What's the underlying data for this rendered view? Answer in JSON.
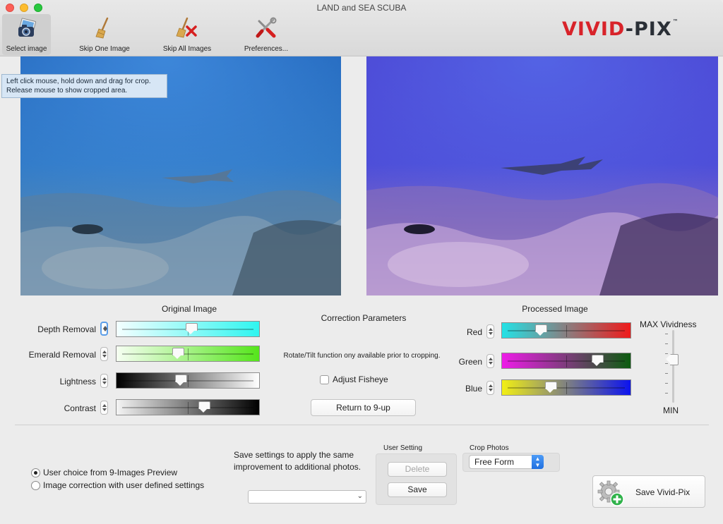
{
  "window": {
    "title": "LAND and SEA SCUBA"
  },
  "toolbar": {
    "items": [
      {
        "label": "Select image",
        "icon": "camera-icon"
      },
      {
        "label": "Skip One Image",
        "icon": "broom-icon"
      },
      {
        "label": "Skip All Images",
        "icon": "broom-cross-icon"
      },
      {
        "label": "Preferences...",
        "icon": "tools-icon"
      }
    ]
  },
  "logo": {
    "part1": "VIVID",
    "part2": "-PIX",
    "tm": "™"
  },
  "tooltip": {
    "line1": "Left click mouse, hold down and drag for crop.",
    "line2": "Release mouse to show cropped area."
  },
  "original": {
    "title": "Original Image",
    "sliders": [
      {
        "label": "Depth Removal",
        "value": 0.52,
        "colors": [
          "#f4ffff",
          "#2ff5f0"
        ]
      },
      {
        "label": "Emerald Removal",
        "value": 0.42,
        "colors": [
          "#f6fff2",
          "#55e51b"
        ]
      },
      {
        "label": "Lightness",
        "value": 0.44,
        "colors": [
          "#000000",
          "#ffffff"
        ]
      },
      {
        "label": "Contrast",
        "value": 0.62,
        "colors": [
          "#f4f4f4",
          "#000000"
        ]
      }
    ]
  },
  "correction": {
    "title": "Correction Parameters",
    "note": "Rotate/Tilt function ony available prior to cropping.",
    "fisheye_label": "Adjust Fisheye",
    "return_label": "Return to 9-up"
  },
  "processed": {
    "title": "Processed Image",
    "sliders": [
      {
        "label": "Red",
        "value": 0.28,
        "colors": [
          "#23e2e6",
          "#ef1b1b"
        ]
      },
      {
        "label": "Green",
        "value": 0.76,
        "colors": [
          "#ee1ce8",
          "#0c5c0f"
        ]
      },
      {
        "label": "Blue",
        "value": 0.36,
        "colors": [
          "#f2ef14",
          "#0c13ef"
        ]
      }
    ]
  },
  "vividness": {
    "max_label": "MAX Vividness",
    "min_label": "MIN",
    "value": 0.6
  },
  "bottom": {
    "radio1": "User choice from 9-Images Preview",
    "radio2": "Image correction with user defined settings",
    "save_text": "Save settings to apply the same improvement to additional photos.",
    "user_setting_title": "User Setting",
    "delete_label": "Delete",
    "save_label": "Save",
    "crop_title": "Crop Photos",
    "crop_value": "Free Form",
    "save_vividpix": "Save Vivid-Pix"
  }
}
